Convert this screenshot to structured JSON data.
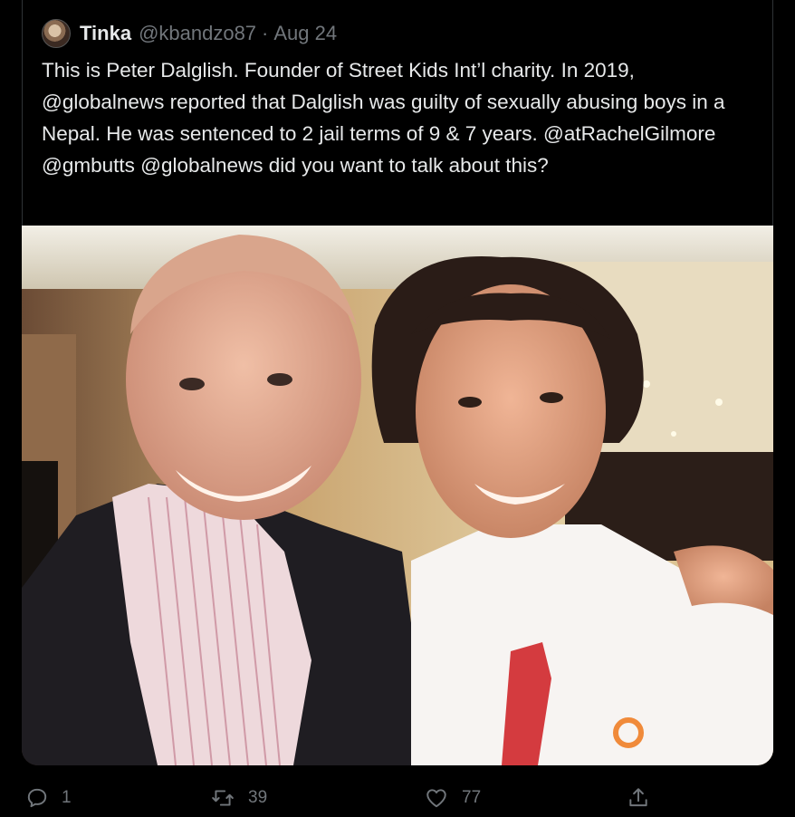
{
  "tweet": {
    "display_name": "Tinka",
    "handle": "@kbandzo87",
    "separator": "·",
    "date": "Aug 24",
    "text": "This is Peter Dalglish. Founder of Street Kids Int’l charity. In 2019, @globalnews reported that Dalglish was guilty of sexually abusing boys in a Nepal. He was sentenced to 2 jail terms of 9 & 7 years. @atRachelGilmore @gmbutts @globalnews did you want to talk about this?"
  },
  "actions": {
    "reply_count": "1",
    "retweet_count": "39",
    "like_count": "77"
  },
  "icons": {
    "reply": "reply-icon",
    "retweet": "retweet-icon",
    "like": "heart-icon",
    "share": "share-icon"
  },
  "colors": {
    "background": "#000000",
    "text": "#e7e9ea",
    "muted": "#71767b",
    "border": "#2f3336"
  }
}
